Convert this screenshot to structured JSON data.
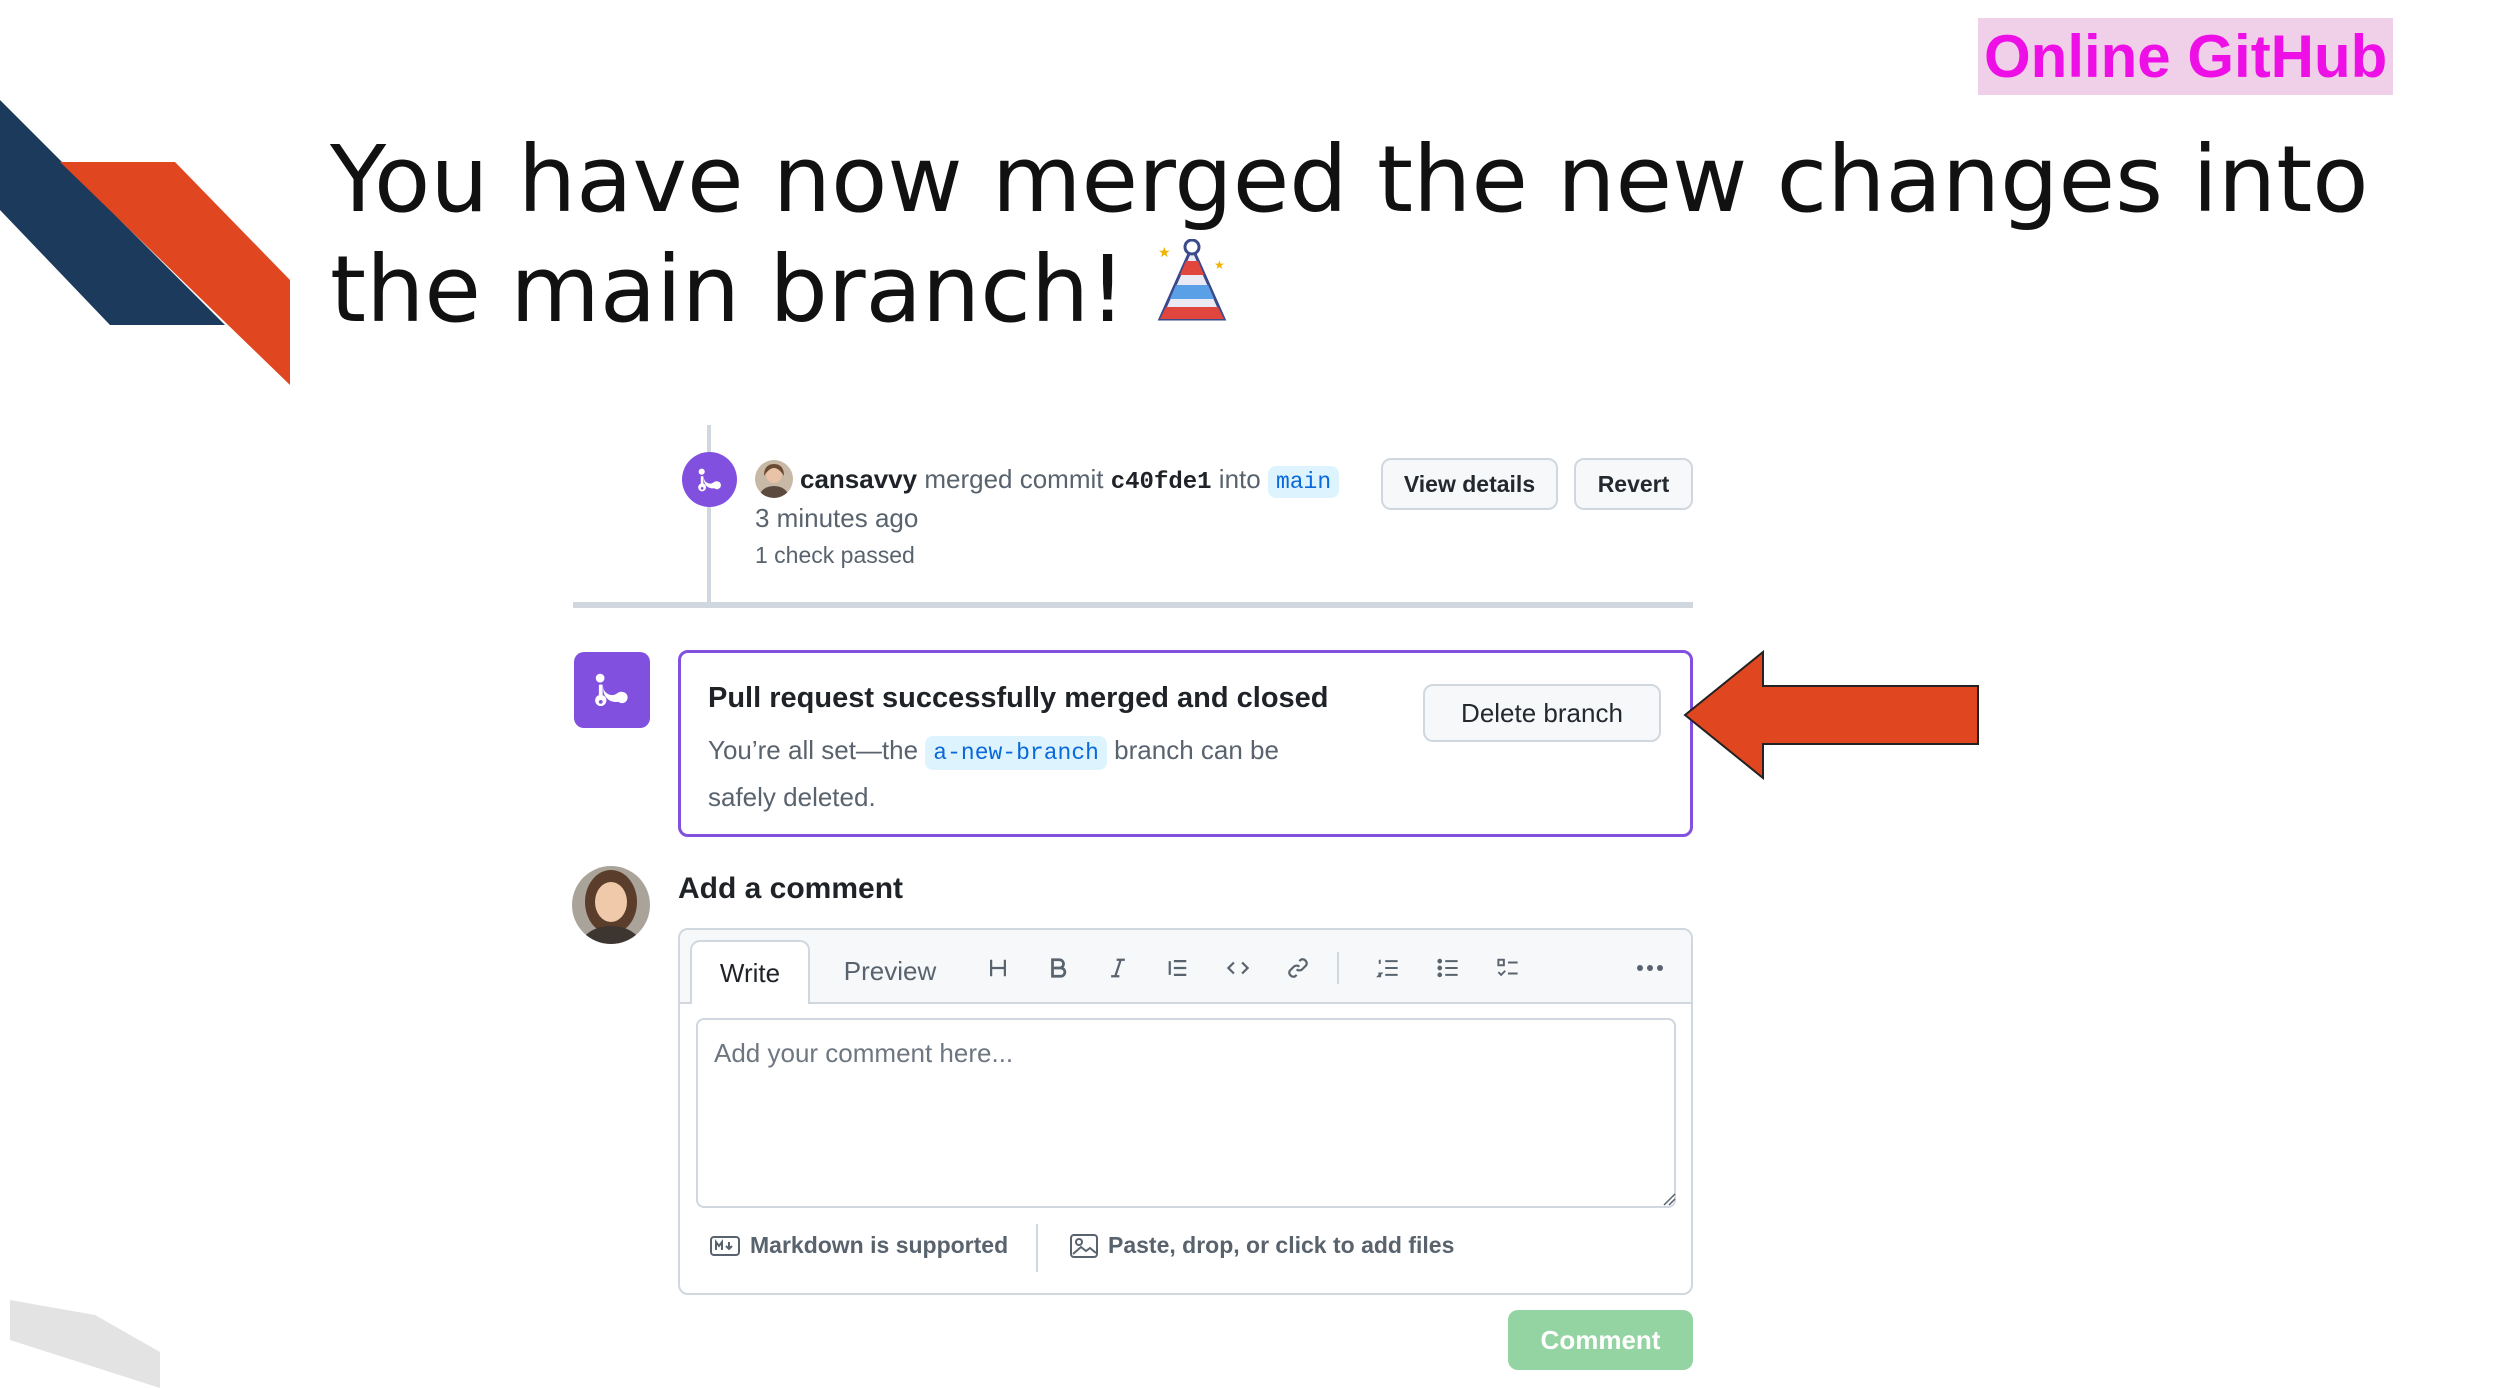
{
  "slide": {
    "tag": "Online GitHub",
    "title": "You have now merged the new changes into the main branch!",
    "decor_colors": {
      "navy": "#1b3a5c",
      "orange": "#e0461f",
      "gray": "#dcdcdc"
    }
  },
  "merge_event": {
    "user": "cansavvy",
    "action": "merged commit",
    "commit": "c40fde1",
    "into_text": "into",
    "branch": "main",
    "time": "3 minutes ago",
    "checks": "1 check passed",
    "view_details_label": "View details",
    "revert_label": "Revert"
  },
  "merged_notice": {
    "title": "Pull request successfully merged and closed",
    "desc_prefix": "You’re all set—the",
    "branch": "a-new-branch",
    "desc_suffix": "branch can be safely deleted.",
    "delete_label": "Delete branch"
  },
  "comment": {
    "heading": "Add a comment",
    "tab_write": "Write",
    "tab_preview": "Preview",
    "placeholder": "Add your comment here...",
    "markdown_note": "Markdown is supported",
    "files_note": "Paste, drop, or click to add files",
    "submit_label": "Comment"
  },
  "toolbar_icons": [
    "heading-icon",
    "bold-icon",
    "italic-icon",
    "quote-icon",
    "code-icon",
    "link-icon",
    "numbered-list-icon",
    "bullet-list-icon",
    "task-list-icon",
    "more-icon"
  ],
  "colors": {
    "accent_purple": "#8250df",
    "arrow": "#e0461f",
    "tag_pink": "#ee0fe6",
    "comment_green": "#94d3a2"
  }
}
